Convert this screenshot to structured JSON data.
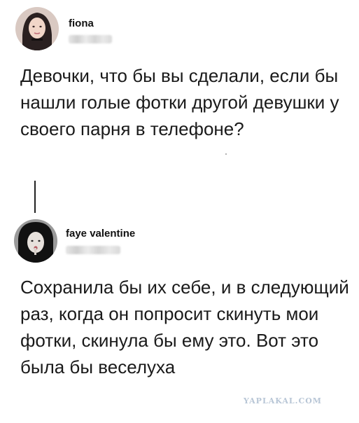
{
  "posts": [
    {
      "username": "fiona",
      "text": "Девочки, что бы вы сделали, если бы нашли голые фотки другой девушки у своего парня в телефоне?"
    },
    {
      "username": "faye valentine",
      "text": "Сохранила бы их себе, и в следующий раз, когда он попросит скинуть мои фотки, скинула бы ему это. Вот это была бы веселуха"
    }
  ],
  "watermark": "YAPLAKAL.COM",
  "colors": {
    "text": "#1a1a1a",
    "watermark": "#b8c6d6",
    "handle_blur": "#d9d9d9"
  }
}
